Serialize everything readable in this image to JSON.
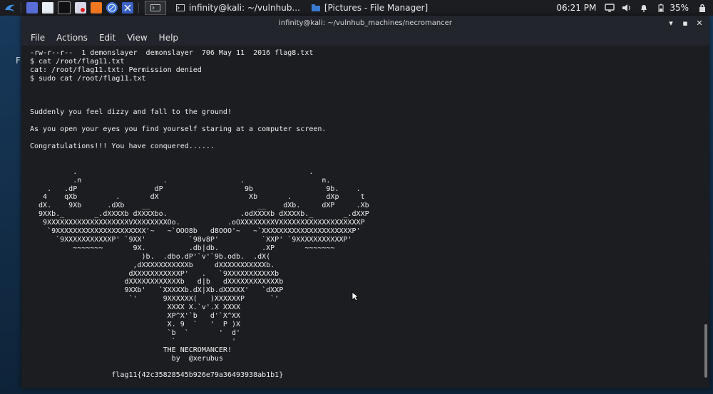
{
  "desktop": {
    "label": "F"
  },
  "panel": {
    "tasks": [
      {
        "label": "infinity@kali: ~/vulnhub..."
      },
      {
        "label": "[Pictures - File Manager]"
      }
    ],
    "clock": "06:21 PM",
    "battery": "35%"
  },
  "window": {
    "title": "infinity@kali: ~/vulnhub_machines/necromancer",
    "menu": [
      "File",
      "Actions",
      "Edit",
      "View",
      "Help"
    ]
  },
  "terminal": {
    "content": "-rw-r--r--  1 demonslayer  demonslayer  706 May 11  2016 flag8.txt\n$ cat /root/flag11.txt\ncat: /root/flag11.txt: Permission denied\n$ sudo cat /root/flag11.txt\n\n\n\nSuddenly you feel dizzy and fall to the ground!\n\nAs you open your eyes you find yourself staring at a computer screen.\n\nCongratulations!!! You have conquered......\n\n\n          .                                                      .\n          .n                   .                 .                  n.\n    .   .dP                  dP                   9b                 9b.    .\n   4    qXb         .       dX                     Xb       .        dXp     t\n  dX.    9Xb      .dXb    __                         __    dXb.     dXP     .Xb\n  9XXb._       _.dXXXXb dXXXXbo.                 .odXXXXb dXXXXb._       _.dXXP\n   9XXXXXXXXXXXXXXXXXXXVXXXXXXXXOo.           .oOXXXXXXXXVXXXXXXXXXXXXXXXXXXXP\n    `9XXXXXXXXXXXXXXXXXXXXX'~   ~`OOO8b   d8OOO'~   ~`XXXXXXXXXXXXXXXXXXXXXP'\n      `9XXXXXXXXXXXP' `9XX'          `98v8P'          `XXP' `9XXXXXXXXXXXP'\n          ~~~~~~~       9X.          .db|db.          .XP       ~~~~~~~\n                          )b.  .dbo.dP'`v'`9b.odb.  .dX(\n                        ,dXXXXXXXXXXXb     dXXXXXXXXXXXb.\n                       dXXXXXXXXXXXP'   .   `9XXXXXXXXXXXb\n                      dXXXXXXXXXXXXb   d|b   dXXXXXXXXXXXXb\n                      9XXb'   `XXXXXb.dX|Xb.dXXXXX'   `dXXP\n                       `'      9XXXXXX(   )XXXXXXP      `'\n                                XXXX X.`v'.X XXXX\n                                XP^X'`b   d'`X^XX\n                                X. 9  `   '  P )X\n                                `b  `       '  d'\n                                 `             '\n                               THE NECROMANCER!\n                                 by  @xerubus\n\n                   flag11{42c35828545b926e79a36493938ab1b1}"
  }
}
